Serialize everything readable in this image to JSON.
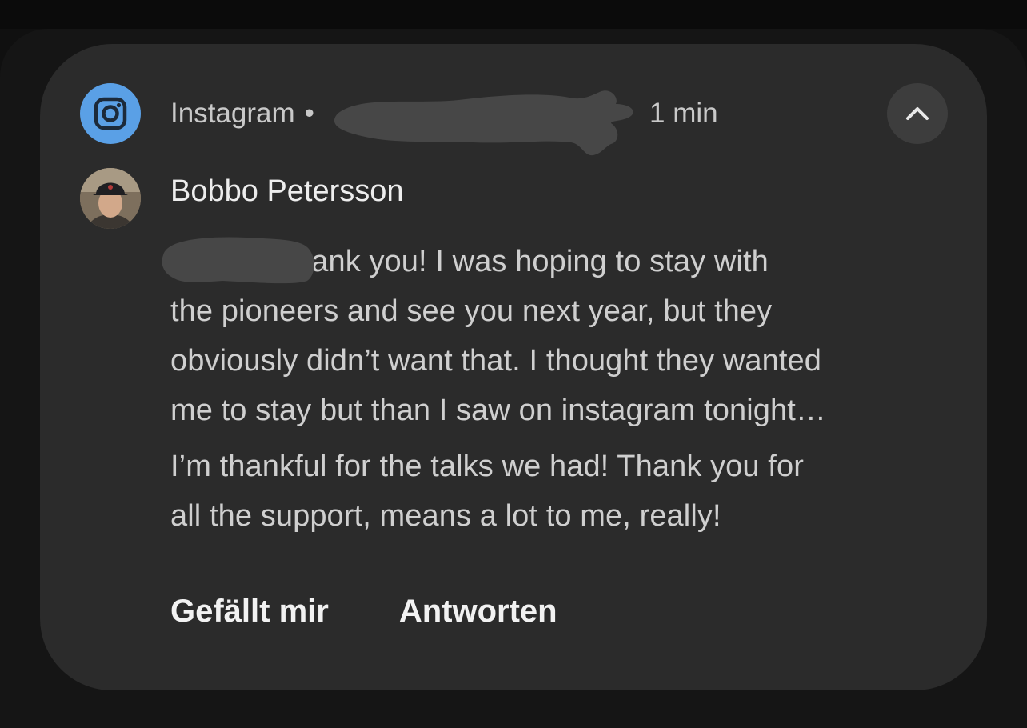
{
  "notification": {
    "app_name": "Instagram",
    "separator": "•",
    "time": "1 min",
    "app_icon": "instagram-icon",
    "collapse_icon": "chevron-up-icon",
    "sender": "Bobbo Petersson",
    "message_lines": [
      "hank you! I was hoping to stay with",
      "the pioneers and see you next year, but they",
      "obviously didn’t want that. I thought they wanted",
      "me to stay but than I saw on instagram tonight…",
      "I’m thankful for the talks we had! Thank you for",
      "all the support, means a lot to me, really!"
    ],
    "actions": {
      "like": "Gefällt mir",
      "reply": "Antworten"
    }
  },
  "colors": {
    "card_background": "#2b2b2b",
    "app_icon_background": "#5aa0e6",
    "redaction": "#474747"
  }
}
